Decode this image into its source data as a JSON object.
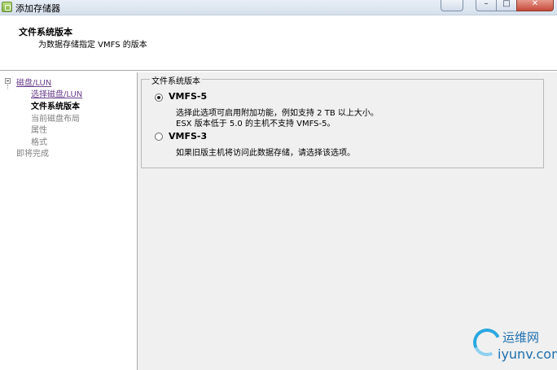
{
  "window": {
    "title": "添加存储器",
    "minimize": "–",
    "maximize": "□",
    "close": "✕"
  },
  "header": {
    "title": "文件系统版本",
    "subtitle": "为数据存储指定 VMFS 的版本"
  },
  "nav": {
    "items": [
      {
        "label": "磁盘/LUN",
        "state": "link"
      },
      {
        "label": "选择磁盘/LUN",
        "state": "link"
      },
      {
        "label": "文件系统版本",
        "state": "current"
      },
      {
        "label": "当前磁盘布局",
        "state": "disabled"
      },
      {
        "label": "属性",
        "state": "disabled"
      },
      {
        "label": "格式",
        "state": "disabled"
      },
      {
        "label": "即将完成",
        "state": "disabled"
      }
    ]
  },
  "main": {
    "group_title": "文件系统版本",
    "options": [
      {
        "label": "VMFS-5",
        "selected": true,
        "desc": [
          "选择此选项可启用附加功能，例如支持 2 TB 以上大小。",
          "ESX 版本低于 5.0 的主机不支持 VMFS-5。"
        ]
      },
      {
        "label": "VMFS-3",
        "selected": false,
        "desc": [
          "如果旧版主机将访问此数据存储，请选择该选项。"
        ]
      }
    ]
  },
  "watermark": {
    "cn": "运维网",
    "en": "iyunv.com"
  }
}
